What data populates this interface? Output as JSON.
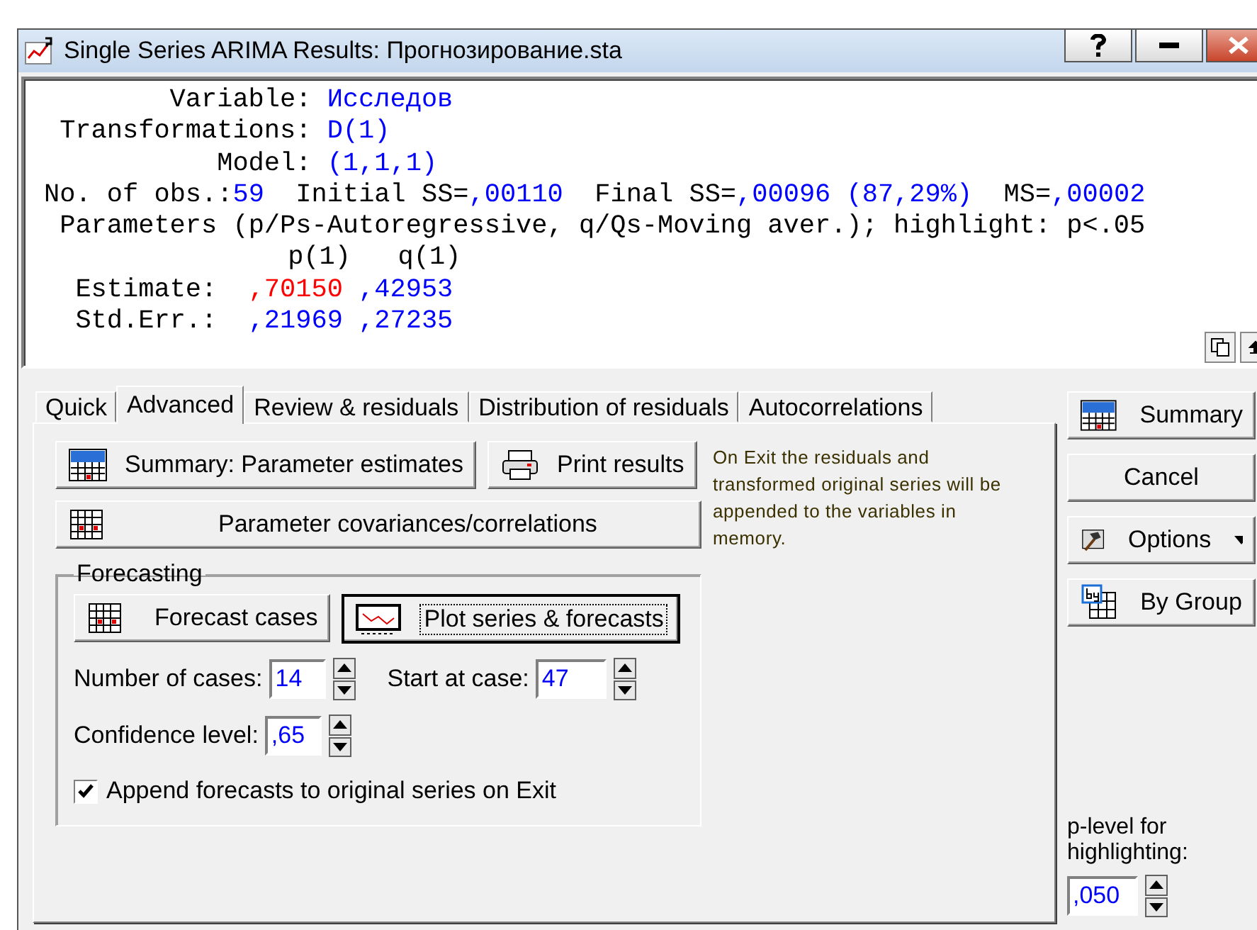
{
  "window": {
    "title": "Single Series ARIMA Results: Прогнозирование.sta"
  },
  "output": {
    "header_rows": [
      {
        "label": "Variable:",
        "value": "Исследов"
      },
      {
        "label": "Transformations:",
        "value": "D(1)"
      },
      {
        "label": "Model:",
        "value": "(1,1,1)"
      }
    ],
    "stats": [
      {
        "label": "No. of obs.:",
        "value": "59"
      },
      {
        "label": "Initial SS=",
        "value": ",00110"
      },
      {
        "label": "Final SS=",
        "value": ",00096 (87,29%)"
      },
      {
        "label": "MS=",
        "value": ",00002"
      }
    ],
    "note": "Parameters (p/Ps-Autoregressive, q/Qs-Moving aver.); highlight: p<.05",
    "parameter_columns": [
      "p(1)",
      "q(1)"
    ],
    "parameter_rows": [
      {
        "label": "Estimate:",
        "values": [
          {
            "text": ",70150",
            "highlighted": true
          },
          {
            "text": ",42953",
            "highlighted": false
          }
        ]
      },
      {
        "label": "Std.Err.:",
        "values": [
          {
            "text": ",21969",
            "highlighted": false
          },
          {
            "text": ",27235",
            "highlighted": false
          }
        ]
      }
    ]
  },
  "tabs": [
    {
      "label": "Quick",
      "selected": false
    },
    {
      "label": "Advanced",
      "selected": true
    },
    {
      "label": "Review & residuals",
      "selected": false
    },
    {
      "label": "Distribution of residuals",
      "selected": false
    },
    {
      "label": "Autocorrelations",
      "selected": false
    }
  ],
  "advanced": {
    "buttons": [
      {
        "label": "Summary:  Parameter estimates",
        "kind": "summary"
      },
      {
        "label": "Print results",
        "kind": "printer"
      },
      {
        "label": "Parameter covariances/correlations",
        "kind": "grid"
      }
    ],
    "info": "On Exit the residuals and transformed original series will be appended to the variables in memory.",
    "forecasting": {
      "title": "Forecasting",
      "buttons": [
        {
          "label": "Forecast cases",
          "kind": "grid",
          "default": false
        },
        {
          "label": "Plot series & forecasts",
          "kind": "plot",
          "default": true
        }
      ],
      "number_of_cases": {
        "label": "Number of cases:",
        "value": "14"
      },
      "start_at_case": {
        "label": "Start at case:",
        "value": "47"
      },
      "confidence_level": {
        "label": "Confidence level:",
        "value": ",65"
      },
      "append": {
        "label": "Append forecasts to original series on Exit",
        "checked": true
      }
    }
  },
  "side_buttons": [
    {
      "label": "Summary",
      "kind": "summary"
    },
    {
      "label": "Cancel",
      "kind": "plain"
    },
    {
      "label": "Options",
      "kind": "options"
    },
    {
      "label": "By Group",
      "kind": "bygroup"
    }
  ],
  "p_level": {
    "label": "p-level for highlighting:",
    "value": ",050"
  }
}
